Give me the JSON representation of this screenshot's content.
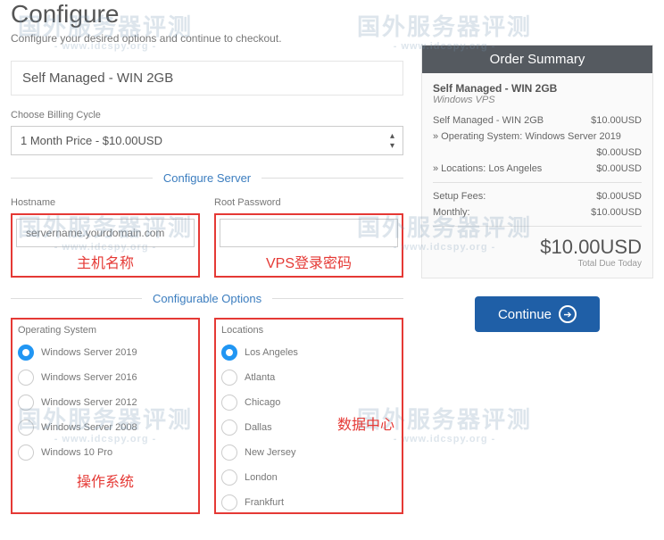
{
  "header": {
    "title": "Configure",
    "subtitle": "Configure your desired options and continue to checkout."
  },
  "product_name": "Self Managed - WIN 2GB",
  "billing": {
    "label": "Choose Billing Cycle",
    "selected": "1 Month Price - $10.00USD"
  },
  "sections": {
    "configure_server": "Configure Server",
    "configurable_options": "Configurable Options"
  },
  "server": {
    "hostname_label": "Hostname",
    "hostname_placeholder": "servername.yourdomain.com",
    "password_label": "Root Password"
  },
  "captions": {
    "hostname_cn": "主机名称",
    "password_cn": "VPS登录密码",
    "os_cn": "操作系统",
    "location_cn": "数据中心"
  },
  "os": {
    "label": "Operating System",
    "options": [
      "Windows Server 2019",
      "Windows Server 2016",
      "Windows Server 2012",
      "Windows Server 2008",
      "Windows 10 Pro"
    ],
    "selected_index": 0
  },
  "locations": {
    "label": "Locations",
    "options": [
      "Los Angeles",
      "Atlanta",
      "Chicago",
      "Dallas",
      "New Jersey",
      "London",
      "Frankfurt"
    ],
    "selected_index": 0
  },
  "summary": {
    "title": "Order Summary",
    "product": "Self Managed - WIN 2GB",
    "category": "Windows VPS",
    "lines": [
      {
        "label": "Self Managed - WIN 2GB",
        "value": "$10.00USD"
      },
      {
        "label": "» Operating System: Windows Server 2019",
        "value": ""
      },
      {
        "label": "",
        "value": "$0.00USD"
      },
      {
        "label": "» Locations: Los Angeles",
        "value": "$0.00USD"
      }
    ],
    "setup_label": "Setup Fees:",
    "setup_value": "$0.00USD",
    "monthly_label": "Monthly:",
    "monthly_value": "$10.00USD",
    "total": "$10.00USD",
    "total_label": "Total Due Today"
  },
  "continue_label": "Continue",
  "watermark": {
    "big": "国外服务器评测",
    "small": "- www.idcspy.org -"
  }
}
